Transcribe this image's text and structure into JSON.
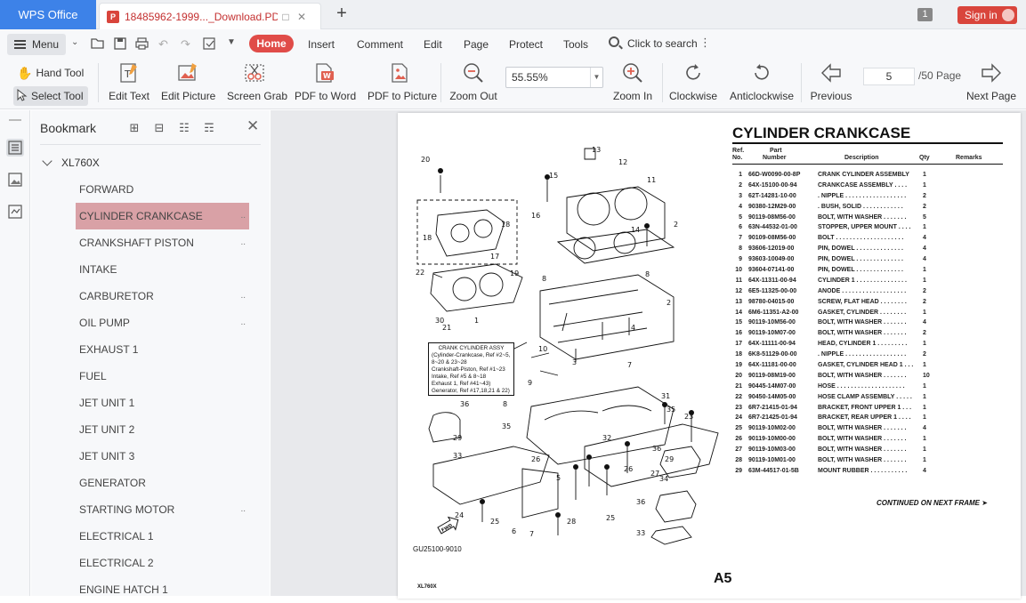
{
  "titlebar": {
    "app_tab": "WPS Office",
    "doc_tab": "18485962-1999..._Download.PDF",
    "page_badge": "1",
    "signin": "Sign in",
    "accent": "#3d82e8"
  },
  "menubar": {
    "menu_label": "Menu",
    "tabs": [
      "Home",
      "Insert",
      "Comment",
      "Edit",
      "Page",
      "Protect",
      "Tools"
    ],
    "search": "Click to search",
    "accent": "#e04c48"
  },
  "toolbar": {
    "hand_tool": "Hand Tool",
    "select_tool": "Select Tool",
    "edit_text": "Edit Text",
    "edit_picture": "Edit Picture",
    "screen_grab": "Screen Grab",
    "pdf_to_word": "PDF to Word",
    "pdf_to_picture": "PDF to Picture",
    "zoom_out": "Zoom Out",
    "zoom_value": "55.55%",
    "zoom_in": "Zoom In",
    "clockwise": "Clockwise",
    "anticlockwise": "Anticlockwise",
    "previous": "Previous",
    "page_number": "5",
    "page_total": "/50 Page",
    "next_page": "Next Page"
  },
  "panel": {
    "title": "Bookmark",
    "root": "XL760X",
    "items": [
      {
        "label": "FORWARD",
        "more": ""
      },
      {
        "label": "CYLINDER CRANKCASE",
        "more": "..",
        "selected": true
      },
      {
        "label": "CRANKSHAFT PISTON",
        "more": ".."
      },
      {
        "label": "INTAKE",
        "more": ""
      },
      {
        "label": "CARBURETOR",
        "more": ".."
      },
      {
        "label": "OIL PUMP",
        "more": ".."
      },
      {
        "label": "EXHAUST 1",
        "more": ""
      },
      {
        "label": "FUEL",
        "more": ""
      },
      {
        "label": "JET UNIT 1",
        "more": ""
      },
      {
        "label": "JET UNIT 2",
        "more": ""
      },
      {
        "label": "JET UNIT 3",
        "more": ""
      },
      {
        "label": "GENERATOR",
        "more": ""
      },
      {
        "label": "STARTING MOTOR",
        "more": ".."
      },
      {
        "label": "ELECTRICAL 1",
        "more": ""
      },
      {
        "label": "ELECTRICAL 2",
        "more": ""
      },
      {
        "label": "ENGINE HATCH 1",
        "more": ""
      }
    ],
    "selected_color": "#d9a1a6"
  },
  "page": {
    "title": "CYLINDER CRANKCASE",
    "headers": {
      "ref": "Ref.",
      "ref2": "No.",
      "part": "Part",
      "part2": "Number",
      "desc": "Description",
      "qty": "Qty",
      "remarks": "Remarks"
    },
    "parts": [
      {
        "ref": "1",
        "num": "66D-W0090-00-8P",
        "desc": "CRANK CYLINDER ASSEMBLY",
        "qty": "1"
      },
      {
        "ref": "2",
        "num": "64X-15100-00-94",
        "desc": "CRANKCASE ASSEMBLY  . . . .",
        "qty": "1"
      },
      {
        "ref": "3",
        "num": "62T-14281-10-00",
        "desc": ". NIPPLE  . . . . . . . . . . . . . . . . . .",
        "qty": "2"
      },
      {
        "ref": "4",
        "num": "90380-12M29-00",
        "desc": ". BUSH, SOLID  . . . . . . . . . . . .",
        "qty": "2"
      },
      {
        "ref": "5",
        "num": "90119-08M56-00",
        "desc": "BOLT, WITH WASHER  . . . . . . .",
        "qty": "5"
      },
      {
        "ref": "6",
        "num": "63N-44532-01-00",
        "desc": "STOPPER, UPPER MOUNT  . . . .",
        "qty": "1"
      },
      {
        "ref": "7",
        "num": "90109-08M56-00",
        "desc": "BOLT  . . . . . . . . . . . . . . . . . . . .",
        "qty": "4"
      },
      {
        "ref": "8",
        "num": "93606-12019-00",
        "desc": "PIN, DOWEL  . . . . . . . . . . . . . .",
        "qty": "4"
      },
      {
        "ref": "9",
        "num": "93603-10049-00",
        "desc": "PIN, DOWEL  . . . . . . . . . . . . . .",
        "qty": "4"
      },
      {
        "ref": "10",
        "num": "93604-07141-00",
        "desc": "PIN, DOWEL  . . . . . . . . . . . . . .",
        "qty": "1"
      },
      {
        "ref": "11",
        "num": "64X-11311-00-94",
        "desc": "CYLINDER 1  . . . . . . . . . . . . . . .",
        "qty": "1"
      },
      {
        "ref": "12",
        "num": "6E5-11325-00-00",
        "desc": "ANODE  . . . . . . . . . . . . . . . . . . .",
        "qty": "2"
      },
      {
        "ref": "13",
        "num": "98780-04015-00",
        "desc": "SCREW, FLAT HEAD  . . . . . . . .",
        "qty": "2"
      },
      {
        "ref": "14",
        "num": "6M6-11351-A2-00",
        "desc": "GASKET, CYLINDER  . . . . . . . .",
        "qty": "1"
      },
      {
        "ref": "15",
        "num": "90119-10M56-00",
        "desc": "BOLT, WITH WASHER  . . . . . . .",
        "qty": "4"
      },
      {
        "ref": "16",
        "num": "90119-10M07-00",
        "desc": "BOLT, WITH WASHER  . . . . . . .",
        "qty": "2"
      },
      {
        "ref": "17",
        "num": "64X-11111-00-94",
        "desc": "HEAD, CYLINDER 1  . . . . . . . . .",
        "qty": "1"
      },
      {
        "ref": "18",
        "num": "6K8-51129-00-00",
        "desc": ". NIPPLE  . . . . . . . . . . . . . . . . . .",
        "qty": "2"
      },
      {
        "ref": "19",
        "num": "64X-11181-00-00",
        "desc": "GASKET, CYLINDER HEAD 1  . . .",
        "qty": "1"
      },
      {
        "ref": "20",
        "num": "90119-08M19-00",
        "desc": "BOLT, WITH WASHER  . . . . . . .",
        "qty": "10"
      },
      {
        "ref": "21",
        "num": "90445-14M07-00",
        "desc": "HOSE  . . . . . . . . . . . . . . . . . . . .",
        "qty": "1"
      },
      {
        "ref": "22",
        "num": "90450-14M05-00",
        "desc": "HOSE CLAMP ASSEMBLY  . . . . .",
        "qty": "1"
      },
      {
        "ref": "23",
        "num": "6R7-21415-01-94",
        "desc": "BRACKET, FRONT UPPER 1  . . .",
        "qty": "1"
      },
      {
        "ref": "24",
        "num": "6R7-21425-01-94",
        "desc": "BRACKET, REAR UPPER 1  . . . .",
        "qty": "1"
      },
      {
        "ref": "25",
        "num": "90119-10M02-00",
        "desc": "BOLT, WITH WASHER  . . . . . . .",
        "qty": "4"
      },
      {
        "ref": "26",
        "num": "90119-10M00-00",
        "desc": "BOLT, WITH WASHER  . . . . . . .",
        "qty": "1"
      },
      {
        "ref": "27",
        "num": "90119-10M03-00",
        "desc": "BOLT, WITH WASHER  . . . . . . .",
        "qty": "1"
      },
      {
        "ref": "28",
        "num": "90119-10M01-00",
        "desc": "BOLT, WITH WASHER  . . . . . . .",
        "qty": "1"
      },
      {
        "ref": "29",
        "num": "63M-44517-01-5B",
        "desc": "MOUNT RUBBER  . . . . . . . . . . .",
        "qty": "4"
      }
    ],
    "continued": "CONTINUED ON NEXT FRAME ➤",
    "frame_label": "A5",
    "model_label": "XL760X",
    "drawing_code": "GU25100-9010",
    "callout": [
      "CRANK CYLINDER ASSY",
      "(Cylinder-Crankcase, Ref #2~5,",
      "  8~20 & 23~28",
      "Crankshaft-Piston, Ref #1~23",
      "Intake, Ref #5 & 8~18",
      "Exhaust 1, Ref #41~43)",
      "Generator, Ref #17,18,21 & 22)"
    ],
    "fwd_label": "FWD",
    "callout_numbers": [
      "13",
      "12",
      "20",
      "15",
      "11",
      "18",
      "18",
      "16",
      "14",
      "2",
      "17",
      "19",
      "8",
      "22",
      "8",
      "30",
      "21",
      "1",
      "4",
      "2",
      "10",
      "3",
      "7",
      "9",
      "8",
      "36",
      "31",
      "35",
      "35",
      "23",
      "29",
      "36",
      "33",
      "29",
      "34",
      "24",
      "25",
      "6",
      "7",
      "28",
      "25",
      "27",
      "26",
      "5",
      "26",
      "32",
      "36",
      "33"
    ]
  }
}
